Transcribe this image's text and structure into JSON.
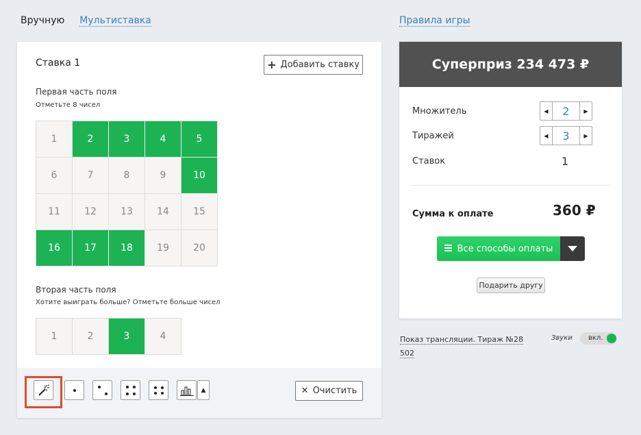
{
  "tabs": {
    "manual": "Вручную",
    "multi": "Мультиставка"
  },
  "rules_link": "Правила игры",
  "bet": {
    "title": "Ставка 1",
    "add_label": "Добавить ставку",
    "part1": {
      "title": "Первая часть поля",
      "hint": "Отметьте 8 чисел",
      "cells": [
        {
          "n": "1",
          "sel": false
        },
        {
          "n": "2",
          "sel": true
        },
        {
          "n": "3",
          "sel": true
        },
        {
          "n": "4",
          "sel": true
        },
        {
          "n": "5",
          "sel": true
        },
        {
          "n": "6",
          "sel": false
        },
        {
          "n": "7",
          "sel": false
        },
        {
          "n": "8",
          "sel": false
        },
        {
          "n": "9",
          "sel": false
        },
        {
          "n": "10",
          "sel": true
        },
        {
          "n": "11",
          "sel": false
        },
        {
          "n": "12",
          "sel": false
        },
        {
          "n": "13",
          "sel": false
        },
        {
          "n": "14",
          "sel": false
        },
        {
          "n": "15",
          "sel": false
        },
        {
          "n": "16",
          "sel": true
        },
        {
          "n": "17",
          "sel": true
        },
        {
          "n": "18",
          "sel": true
        },
        {
          "n": "19",
          "sel": false
        },
        {
          "n": "20",
          "sel": false
        }
      ]
    },
    "part2": {
      "title": "Вторая часть поля",
      "hint": "Хотите выиграть больше? Отметьте больше чисел",
      "cells": [
        {
          "n": "1",
          "sel": false
        },
        {
          "n": "2",
          "sel": false
        },
        {
          "n": "3",
          "sel": true
        },
        {
          "n": "4",
          "sel": false
        }
      ]
    },
    "toolbar": {
      "tools": [
        "magic-wand-icon",
        "dice-one-icon",
        "dice-two-icon",
        "dice-four-icon",
        "dice-four-alt-icon",
        "bar-chart-icon"
      ],
      "clear_label": "Очистить"
    }
  },
  "summary": {
    "superprize": "Суперприз 234 473 ₽",
    "multiplier_label": "Множитель",
    "multiplier_value": "2",
    "draws_label": "Тиражей",
    "draws_value": "3",
    "bets_label": "Ставок",
    "bets_value": "1",
    "total_label": "Сумма к оплате",
    "total_value": "360 ₽",
    "pay_label": "Все способы оплаты",
    "gift_label": "Подарить другу"
  },
  "stream": {
    "text": "Показ трансляции. Тираж №28 502"
  },
  "sounds": {
    "label": "Звуки",
    "toggle_label": "вкл.",
    "on": true
  },
  "colors": {
    "selected": "#1db354",
    "highlight": "#e04b2d",
    "header": "#515151"
  }
}
